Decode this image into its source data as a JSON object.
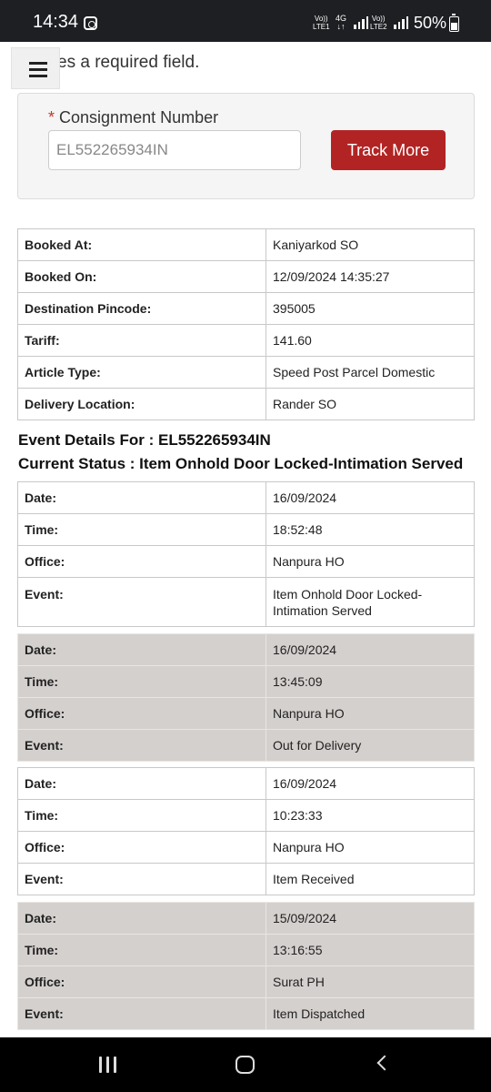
{
  "status_bar": {
    "time": "14:34",
    "sim1_line1": "Vo))",
    "sim1_line2": "LTE1",
    "network_type": "4G",
    "sim2_line1": "Vo))",
    "sim2_line2": "LTE2",
    "battery": "50%"
  },
  "form": {
    "required_note_visible": "cates a required field.",
    "required_star": "*",
    "consignment_label": "Consignment Number",
    "consignment_value": "EL552265934IN",
    "track_button": "Track More"
  },
  "booking": [
    {
      "label": "Booked At:",
      "value": "Kaniyarkod SO"
    },
    {
      "label": "Booked On:",
      "value": "12/09/2024 14:35:27"
    },
    {
      "label": "Destination Pincode:",
      "value": "395005"
    },
    {
      "label": "Tariff:",
      "value": "141.60"
    },
    {
      "label": "Article Type:",
      "value": "Speed Post Parcel Domestic"
    },
    {
      "label": "Delivery Location:",
      "value": "Rander SO"
    }
  ],
  "event_details_heading": "Event Details For : EL552265934IN",
  "current_status_heading": "Current Status : Item Onhold Door Locked-Intimation Served",
  "labels": {
    "date": "Date:",
    "time": "Time:",
    "office": "Office:",
    "event": "Event:"
  },
  "events": [
    {
      "date": "16/09/2024",
      "time": "18:52:48",
      "office": "Nanpura HO",
      "event": "Item Onhold Door Locked-Intimation Served"
    },
    {
      "date": "16/09/2024",
      "time": "13:45:09",
      "office": "Nanpura HO",
      "event": "Out for Delivery"
    },
    {
      "date": "16/09/2024",
      "time": "10:23:33",
      "office": "Nanpura HO",
      "event": "Item Received"
    },
    {
      "date": "15/09/2024",
      "time": "13:16:55",
      "office": "Surat PH",
      "event": "Item Dispatched"
    }
  ],
  "colors": {
    "accent_button": "#b22424",
    "shaded_row": "#d4d0ce",
    "required_star": "#c0392b"
  },
  "icons": [
    "instagram-icon",
    "signal-icon",
    "battery-icon",
    "menu-icon",
    "recent-apps-icon",
    "home-icon",
    "back-icon"
  ]
}
